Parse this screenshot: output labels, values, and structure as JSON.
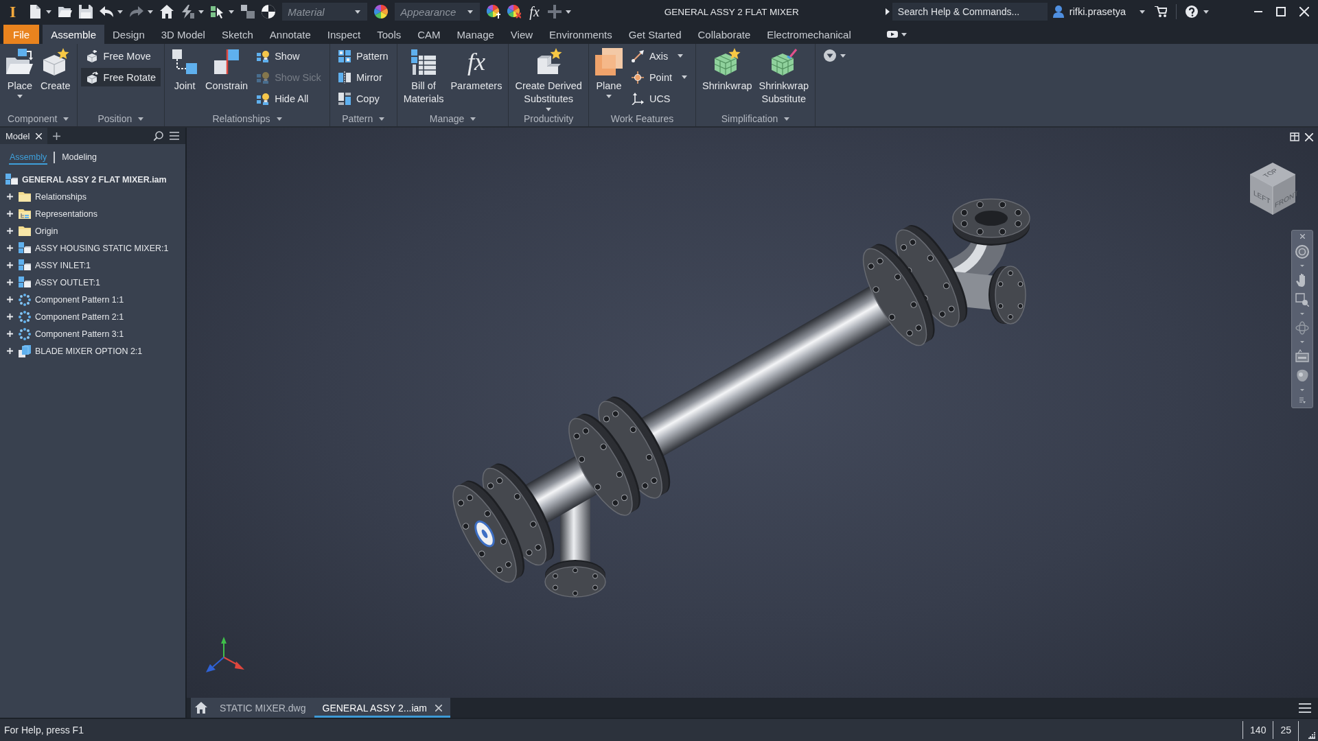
{
  "title_bar": {
    "logo": "I",
    "material": {
      "placeholder": "Material"
    },
    "appearance": {
      "placeholder": "Appearance"
    },
    "formula": "fx",
    "title": "GENERAL ASSY 2 FLAT MIXER",
    "search": {
      "placeholder": "Search Help & Commands..."
    },
    "user": "rifki.prasetya"
  },
  "ribbon_tabs": [
    {
      "label": "File",
      "kind": "menu",
      "selected": false
    },
    {
      "label": "Assemble",
      "kind": "tab",
      "selected": true
    },
    {
      "label": "Design",
      "kind": "tab",
      "selected": false
    },
    {
      "label": "3D Model",
      "kind": "tab",
      "selected": false
    },
    {
      "label": "Sketch",
      "kind": "tab",
      "selected": false
    },
    {
      "label": "Annotate",
      "kind": "tab",
      "selected": false
    },
    {
      "label": "Inspect",
      "kind": "tab",
      "selected": false
    },
    {
      "label": "Tools",
      "kind": "tab",
      "selected": false
    },
    {
      "label": "CAM",
      "kind": "tab",
      "selected": false
    },
    {
      "label": "Manage",
      "kind": "tab",
      "selected": false
    },
    {
      "label": "View",
      "kind": "tab",
      "selected": false
    },
    {
      "label": "Environments",
      "kind": "tab",
      "selected": false
    },
    {
      "label": "Get Started",
      "kind": "tab",
      "selected": false
    },
    {
      "label": "Collaborate",
      "kind": "tab",
      "selected": false
    },
    {
      "label": "Electromechanical",
      "kind": "tab",
      "selected": false
    }
  ],
  "ribbon_groups": [
    {
      "label": "Component",
      "menu": true,
      "tools": [
        {
          "label": "Place",
          "kind": "large",
          "menu": true,
          "disabled": false,
          "highlighted": false
        },
        {
          "label": "Create",
          "kind": "large",
          "menu": false,
          "disabled": false,
          "highlighted": false
        }
      ]
    },
    {
      "label": "Position",
      "menu": true,
      "tools": [
        {
          "label": "Free Move",
          "kind": "small",
          "menu": false,
          "disabled": false,
          "highlighted": false
        },
        {
          "label": "Free Rotate",
          "kind": "small",
          "menu": false,
          "disabled": false,
          "highlighted": true
        }
      ]
    },
    {
      "label": "Relationships",
      "menu": true,
      "tools": [
        {
          "label": "Joint",
          "kind": "large",
          "menu": false,
          "disabled": false,
          "highlighted": false
        },
        {
          "label": "Constrain",
          "kind": "large",
          "menu": false,
          "disabled": false,
          "highlighted": false
        },
        {
          "label": "Show",
          "kind": "small",
          "menu": false,
          "disabled": false,
          "highlighted": false
        },
        {
          "label": "Show Sick",
          "kind": "small",
          "menu": false,
          "disabled": true,
          "highlighted": false
        },
        {
          "label": "Hide All",
          "kind": "small",
          "menu": false,
          "disabled": false,
          "highlighted": false
        }
      ]
    },
    {
      "label": "Pattern",
      "menu": true,
      "tools": [
        {
          "label": "Pattern",
          "kind": "small",
          "menu": false,
          "disabled": false,
          "highlighted": false
        },
        {
          "label": "Mirror",
          "kind": "small",
          "menu": false,
          "disabled": false,
          "highlighted": false
        },
        {
          "label": "Copy",
          "kind": "small",
          "menu": false,
          "disabled": false,
          "highlighted": false
        }
      ]
    },
    {
      "label": "Manage",
      "menu": true,
      "tools": [
        {
          "label": "Bill of\nMaterials",
          "kind": "large",
          "menu": false,
          "disabled": false,
          "highlighted": false
        },
        {
          "label": "Parameters",
          "kind": "large",
          "glyph": "fx",
          "menu": false,
          "disabled": false,
          "highlighted": false
        }
      ]
    },
    {
      "label": "Productivity",
      "menu": false,
      "tools": [
        {
          "label": "Create Derived\nSubstitutes",
          "kind": "large",
          "menu": true,
          "disabled": false,
          "highlighted": false
        }
      ]
    },
    {
      "label": "Work Features",
      "menu": false,
      "tools": [
        {
          "label": "Plane",
          "kind": "large",
          "menu": true,
          "disabled": false,
          "highlighted": false
        },
        {
          "label": "Axis",
          "kind": "small",
          "menu": true,
          "disabled": false,
          "highlighted": false
        },
        {
          "label": "Point",
          "kind": "small",
          "menu": true,
          "disabled": false,
          "highlighted": false
        },
        {
          "label": "UCS",
          "kind": "small",
          "menu": false,
          "disabled": false,
          "highlighted": false
        }
      ]
    },
    {
      "label": "Simplification",
      "menu": true,
      "tools": [
        {
          "label": "Shrinkwrap",
          "kind": "large",
          "menu": false,
          "disabled": false,
          "highlighted": false
        },
        {
          "label": "Shrinkwrap\nSubstitute",
          "kind": "large",
          "menu": false,
          "disabled": false,
          "highlighted": false
        }
      ]
    }
  ],
  "browser": {
    "tab": "Model",
    "modes": [
      {
        "label": "Assembly",
        "selected": true
      },
      {
        "label": "Modeling",
        "selected": false
      }
    ],
    "tree": {
      "label": "GENERAL ASSY 2 FLAT MIXER.iam",
      "kind": "assembly",
      "children": [
        {
          "label": "Relationships",
          "kind": "folder",
          "expanded": false
        },
        {
          "label": "Representations",
          "kind": "views",
          "expanded": false
        },
        {
          "label": "Origin",
          "kind": "folder",
          "expanded": false
        },
        {
          "label": "ASSY HOUSING STATIC MIXER:1",
          "kind": "assembly",
          "expanded": false
        },
        {
          "label": "ASSY INLET:1",
          "kind": "assembly",
          "expanded": false
        },
        {
          "label": "ASSY OUTLET:1",
          "kind": "assembly",
          "expanded": false
        },
        {
          "label": "Component Pattern 1:1",
          "kind": "pattern",
          "expanded": false
        },
        {
          "label": "Component Pattern 2:1",
          "kind": "pattern",
          "expanded": false
        },
        {
          "label": "Component Pattern 3:1",
          "kind": "pattern",
          "expanded": false
        },
        {
          "label": "BLADE MIXER OPTION 2:1",
          "kind": "part",
          "expanded": false
        }
      ]
    }
  },
  "viewport": {
    "view_cube": {
      "faces": [
        "TOP",
        "LEFT",
        "FRONT"
      ]
    }
  },
  "document_tabs": [
    {
      "label": "STATIC MIXER.dwg",
      "selected": false
    },
    {
      "label": "GENERAL ASSY 2...iam",
      "selected": true
    }
  ],
  "status_bar": {
    "help": "For Help, press F1",
    "fields": [
      "140",
      "25"
    ]
  }
}
